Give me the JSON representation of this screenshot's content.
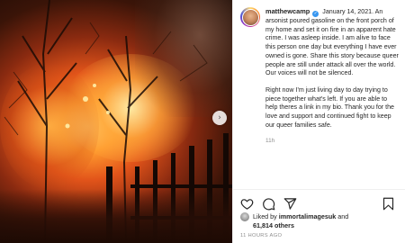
{
  "post": {
    "username": "matthewcamp",
    "verified_mark": "✓",
    "date": "January 14, 2021.",
    "caption_paragraphs": [
      "An arsonist poured gasoline on the front porch of my home and set it on fire in an apparent hate crime. I was asleep inside. I am alive to face this person one day but everything I have ever owned is gone. Share this story because queer people are still under attack all over the world. Our voices will not be silenced.",
      "Right now I'm just living day to day trying to piece together what's left. If you are able to help theres a link in my bio. Thank you for the love and support and continued fight to keep our queer families safe."
    ],
    "comment_time": "11h",
    "liked_by_prefix": "Liked by",
    "liked_by_user": "immortalimagesuk",
    "liked_by_and": "and",
    "others_count": "61,814 others",
    "posted_ago": "11 HOURS AGO"
  },
  "carousel": {
    "next_icon": "chevron-right-icon",
    "next_glyph": "›"
  },
  "actions": {
    "like_icon": "heart-icon",
    "comment_icon": "comment-icon",
    "share_icon": "share-icon",
    "save_icon": "bookmark-icon"
  },
  "colors": {
    "text": "#262626",
    "muted": "#8e8e8e",
    "verified": "#3897f0",
    "border": "#efefef"
  }
}
